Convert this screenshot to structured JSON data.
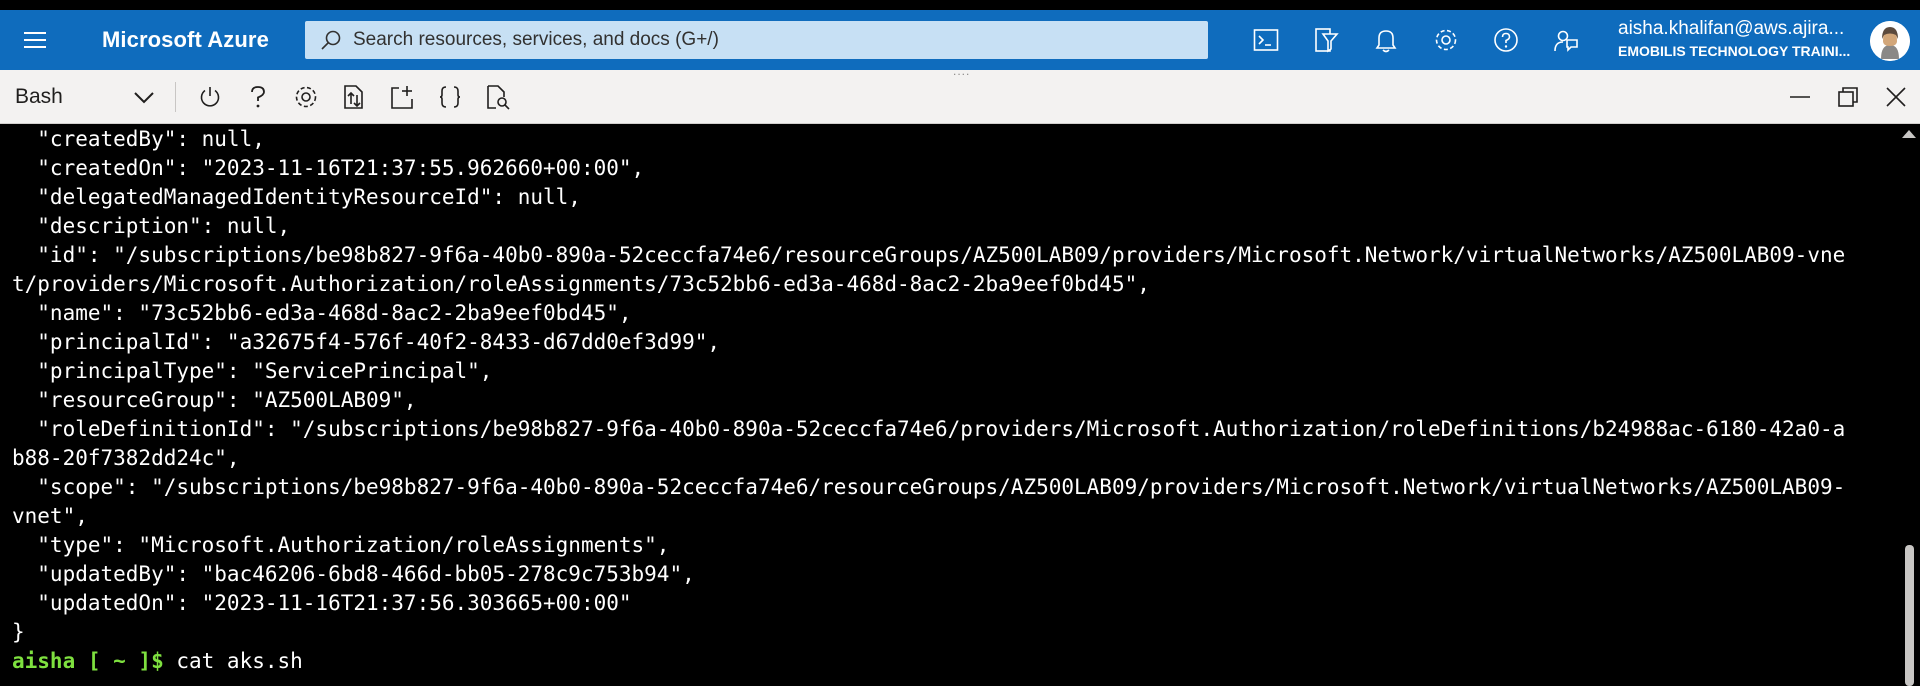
{
  "header": {
    "brand": "Microsoft Azure",
    "search_placeholder": "Search resources, services, and docs (G+/)",
    "icons": [
      "cloud-shell-icon",
      "directory-filter-icon",
      "notifications-icon",
      "settings-icon",
      "help-icon",
      "feedback-icon"
    ],
    "account_email": "aisha.khalifan@aws.ajira...",
    "account_tenant": "EMOBILIS TECHNOLOGY TRAINI..."
  },
  "shell_toolbar": {
    "shell_type": "Bash",
    "drag_handle": "....",
    "icons": [
      "power-icon",
      "help-icon",
      "settings-icon",
      "upload-download-icon",
      "open-new-session-icon",
      "editor-braces-icon",
      "web-preview-icon"
    ],
    "window_controls": [
      "minimize-icon",
      "restore-icon",
      "close-icon"
    ]
  },
  "terminal": {
    "lines": [
      "  \"createdBy\": null,",
      "  \"createdOn\": \"2023-11-16T21:37:55.962660+00:00\",",
      "  \"delegatedManagedIdentityResourceId\": null,",
      "  \"description\": null,",
      "  \"id\": \"/subscriptions/be98b827-9f6a-40b0-890a-52ceccfa74e6/resourceGroups/AZ500LAB09/providers/Microsoft.Network/virtualNetworks/AZ500LAB09-vne",
      "t/providers/Microsoft.Authorization/roleAssignments/73c52bb6-ed3a-468d-8ac2-2ba9eef0bd45\",",
      "  \"name\": \"73c52bb6-ed3a-468d-8ac2-2ba9eef0bd45\",",
      "  \"principalId\": \"a32675f4-576f-40f2-8433-d67dd0ef3d99\",",
      "  \"principalType\": \"ServicePrincipal\",",
      "  \"resourceGroup\": \"AZ500LAB09\",",
      "  \"roleDefinitionId\": \"/subscriptions/be98b827-9f6a-40b0-890a-52ceccfa74e6/providers/Microsoft.Authorization/roleDefinitions/b24988ac-6180-42a0-a",
      "b88-20f7382dd24c\",",
      "  \"scope\": \"/subscriptions/be98b827-9f6a-40b0-890a-52ceccfa74e6/resourceGroups/AZ500LAB09/providers/Microsoft.Network/virtualNetworks/AZ500LAB09-",
      "vnet\",",
      "  \"type\": \"Microsoft.Authorization/roleAssignments\",",
      "  \"updatedBy\": \"bac46206-6bd8-466d-bb05-278c9c753b94\",",
      "  \"updatedOn\": \"2023-11-16T21:37:56.303665+00:00\"",
      "}"
    ],
    "prompt": "aisha [ ~ ]$",
    "command": " cat aks.sh"
  },
  "colors": {
    "header_bg": "#0f6cbd",
    "search_bg": "#c7e0f4",
    "toolbar_bg": "#f3f2f1",
    "terminal_bg": "#000000",
    "prompt_color": "#7ee03f"
  }
}
